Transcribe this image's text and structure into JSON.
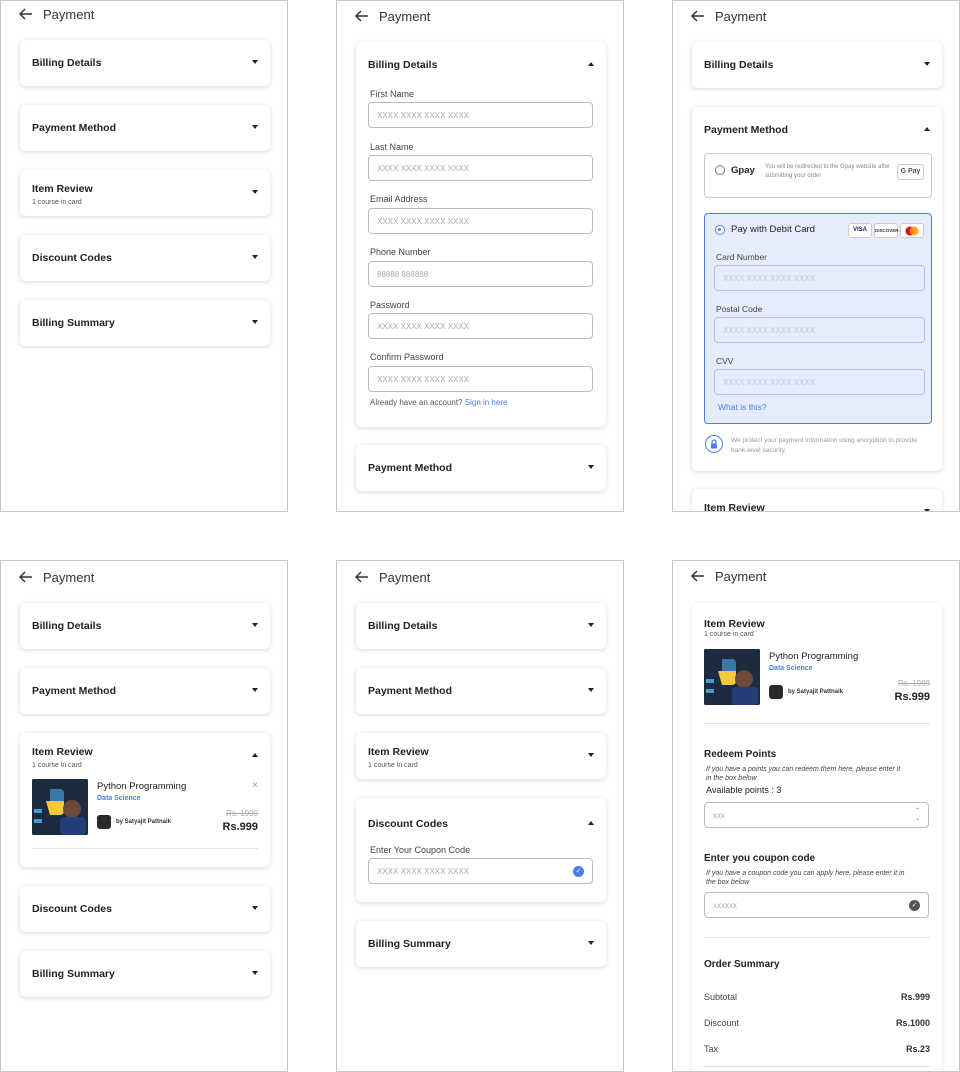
{
  "header": {
    "title": "Payment"
  },
  "sections": {
    "billing_details": "Billing Details",
    "payment_method": "Payment Method",
    "item_review": "Item Review",
    "item_review_sub": "1 course in card",
    "discount_codes": "Discount Codes",
    "billing_summary": "Billing Summary"
  },
  "billing_form": {
    "first_name_label": "First Name",
    "first_name_placeholder": "XXXX XXXX XXXX XXXX",
    "last_name_label": "Last Name",
    "last_name_placeholder": "XXXX XXXX XXXX XXXX",
    "email_label": "Email Address",
    "email_placeholder": "XXXX XXXX XXXX XXXX",
    "phone_label": "Phone Number",
    "phone_placeholder": "88888 888888",
    "password_label": "Password",
    "password_placeholder": "XXXX XXXX XXXX XXXX",
    "confirm_label": "Confirm Password",
    "confirm_placeholder": "XXXX XXXX XXXX XXXX",
    "have_account": "Already have an account?",
    "sign_in": "Sign in here"
  },
  "payment": {
    "gpay_label": "Gpay",
    "gpay_note": "You will be redirected to the Gpay website after submitting your order",
    "gpay_badge": "G Pay",
    "debit_label": "Pay with Debit Card",
    "visa": "VISA",
    "discover": "DISCOVER",
    "card_number_label": "Card Number",
    "card_number_placeholder": "XXXX XXXX XXXX XXXX",
    "postal_label": "Postal Code",
    "postal_placeholder": "XXXX XXXX XXXX XXXX",
    "cvv_label": "CVV",
    "cvv_placeholder": "XXXX XXXX XXXX XXXX",
    "what_is_this": "What is this?",
    "security_note": "We protect your payment information using encryption to provide bank-level security."
  },
  "course": {
    "title": "Python Programming",
    "category": "Data Science",
    "author": "by Satyajit Pattnaik",
    "old_price": "Rs. 1999",
    "price": "Rs.999",
    "remove": "×"
  },
  "discount": {
    "coupon_label": "Enter Your Coupon Code",
    "coupon_placeholder": "XXXX XXXX XXXX XXXX"
  },
  "summary": {
    "redeem_title": "Redeem Points",
    "redeem_note": "If you have a points you can redeem them here, please enter it in the box below",
    "available": "Available points : 3",
    "points_placeholder": "xxx",
    "coupon_title": "Enter you coupon code",
    "coupon_note": "If you have a coupon code you can apply here, please enter it in the box below",
    "coupon_placeholder": "xxxxxx",
    "order_summary": "Order Summary",
    "subtotal_label": "Subtotal",
    "subtotal": "Rs.999",
    "discount_label": "Discount",
    "discount": "Rs.1000",
    "tax_label": "Tax",
    "tax": "Rs.23"
  },
  "colors": {
    "accent": "#4a7ee5",
    "selected_bg": "#e6ecfb",
    "mastercard_red": "#eb001b",
    "mastercard_orange": "#f79e1b"
  }
}
